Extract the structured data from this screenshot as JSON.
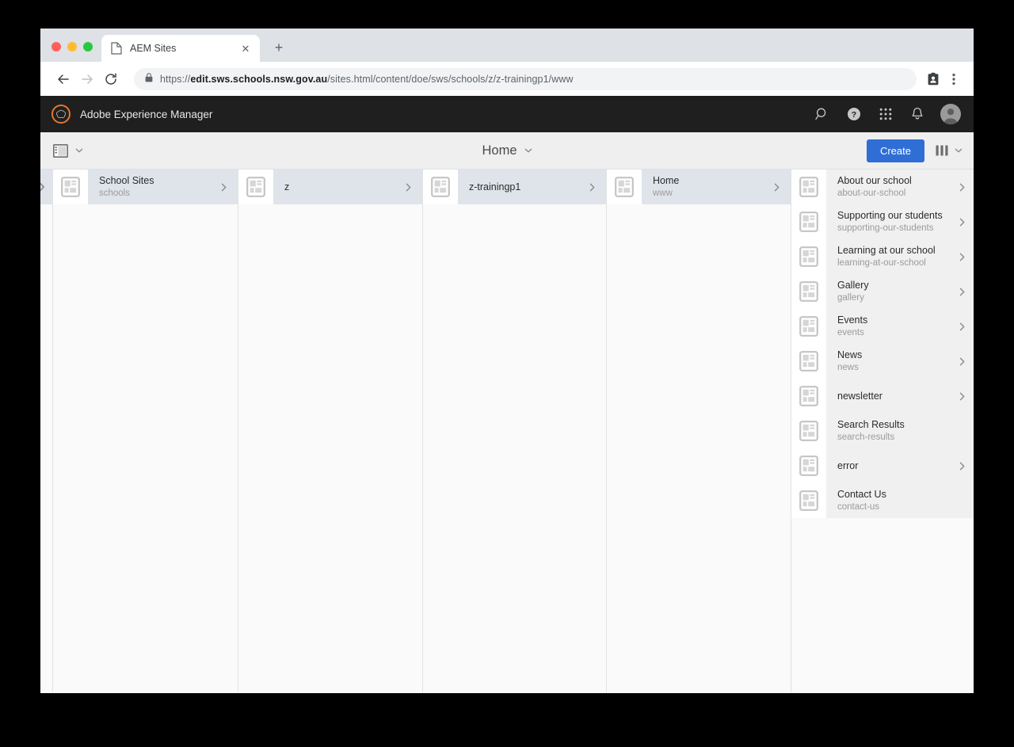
{
  "browser": {
    "tab": {
      "title": "AEM Sites",
      "favicon": "page-icon",
      "close_label": "✕",
      "new_tab_label": "+"
    },
    "nav": {
      "back": "←",
      "forward": "→",
      "reload": "↻"
    },
    "url": {
      "lock": "lock-icon",
      "scheme": "https://",
      "host": "edit.sws.schools.nsw.gov.au",
      "path": "/sites.html/content/doe/sws/schools/z/z-trainingp1/www",
      "full": "https://edit.sws.schools.nsw.gov.au/sites.html/content/doe/sws/schools/z/z-trainingp1/www"
    },
    "toolbar_icons": {
      "profile": "profile-card-icon",
      "menu": "three-dot-menu-icon"
    }
  },
  "aem": {
    "header": {
      "brand": "Adobe Experience Manager",
      "logo": "adobe-experience-manager-logo",
      "actions": [
        {
          "name": "search-icon",
          "label": "Search"
        },
        {
          "name": "help-icon",
          "label": "Help"
        },
        {
          "name": "apps-grid-icon",
          "label": "Solutions"
        },
        {
          "name": "bell-icon",
          "label": "Notifications"
        },
        {
          "name": "avatar",
          "label": "User"
        }
      ]
    },
    "toolbar": {
      "rail_toggle": "rail-toggle-icon",
      "title": "Home",
      "title_chevron": "chevron-down-icon",
      "create_label": "Create",
      "view_icon": "column-view-icon",
      "view_chevron": "chevron-down-icon"
    },
    "columns": [
      {
        "name": "column-school-sites",
        "entries": [
          {
            "title": "School Sites",
            "sub": "schools",
            "state": "selected",
            "chevron": true
          }
        ]
      },
      {
        "name": "column-z",
        "entries": [
          {
            "title": "z",
            "sub": "",
            "state": "selected",
            "chevron": true
          }
        ]
      },
      {
        "name": "column-z-trainingp1",
        "entries": [
          {
            "title": "z-trainingp1",
            "sub": "",
            "state": "selected",
            "chevron": true
          }
        ]
      },
      {
        "name": "column-home",
        "entries": [
          {
            "title": "Home",
            "sub": "www",
            "state": "selected",
            "chevron": true,
            "highlighted": true
          }
        ]
      },
      {
        "name": "column-www-children",
        "entries": [
          {
            "title": "About our school",
            "sub": "about-our-school",
            "state": "plain",
            "chevron": true
          },
          {
            "title": "Supporting our students",
            "sub": "supporting-our-students",
            "state": "plain",
            "chevron": true
          },
          {
            "title": "Learning at our school",
            "sub": "learning-at-our-school",
            "state": "plain",
            "chevron": true
          },
          {
            "title": "Gallery",
            "sub": "gallery",
            "state": "plain",
            "chevron": true
          },
          {
            "title": "Events",
            "sub": "events",
            "state": "plain",
            "chevron": true
          },
          {
            "title": "News",
            "sub": "news",
            "state": "plain",
            "chevron": true
          },
          {
            "title": "newsletter",
            "sub": "",
            "state": "plain",
            "chevron": true
          },
          {
            "title": "Search Results",
            "sub": "search-results",
            "state": "plain",
            "chevron": false
          },
          {
            "title": "error",
            "sub": "",
            "state": "plain",
            "chevron": true
          },
          {
            "title": "Contact Us",
            "sub": "contact-us",
            "state": "plain",
            "chevron": false
          }
        ]
      }
    ],
    "annotation": {
      "color": "#fb0007",
      "target": "Home"
    }
  }
}
